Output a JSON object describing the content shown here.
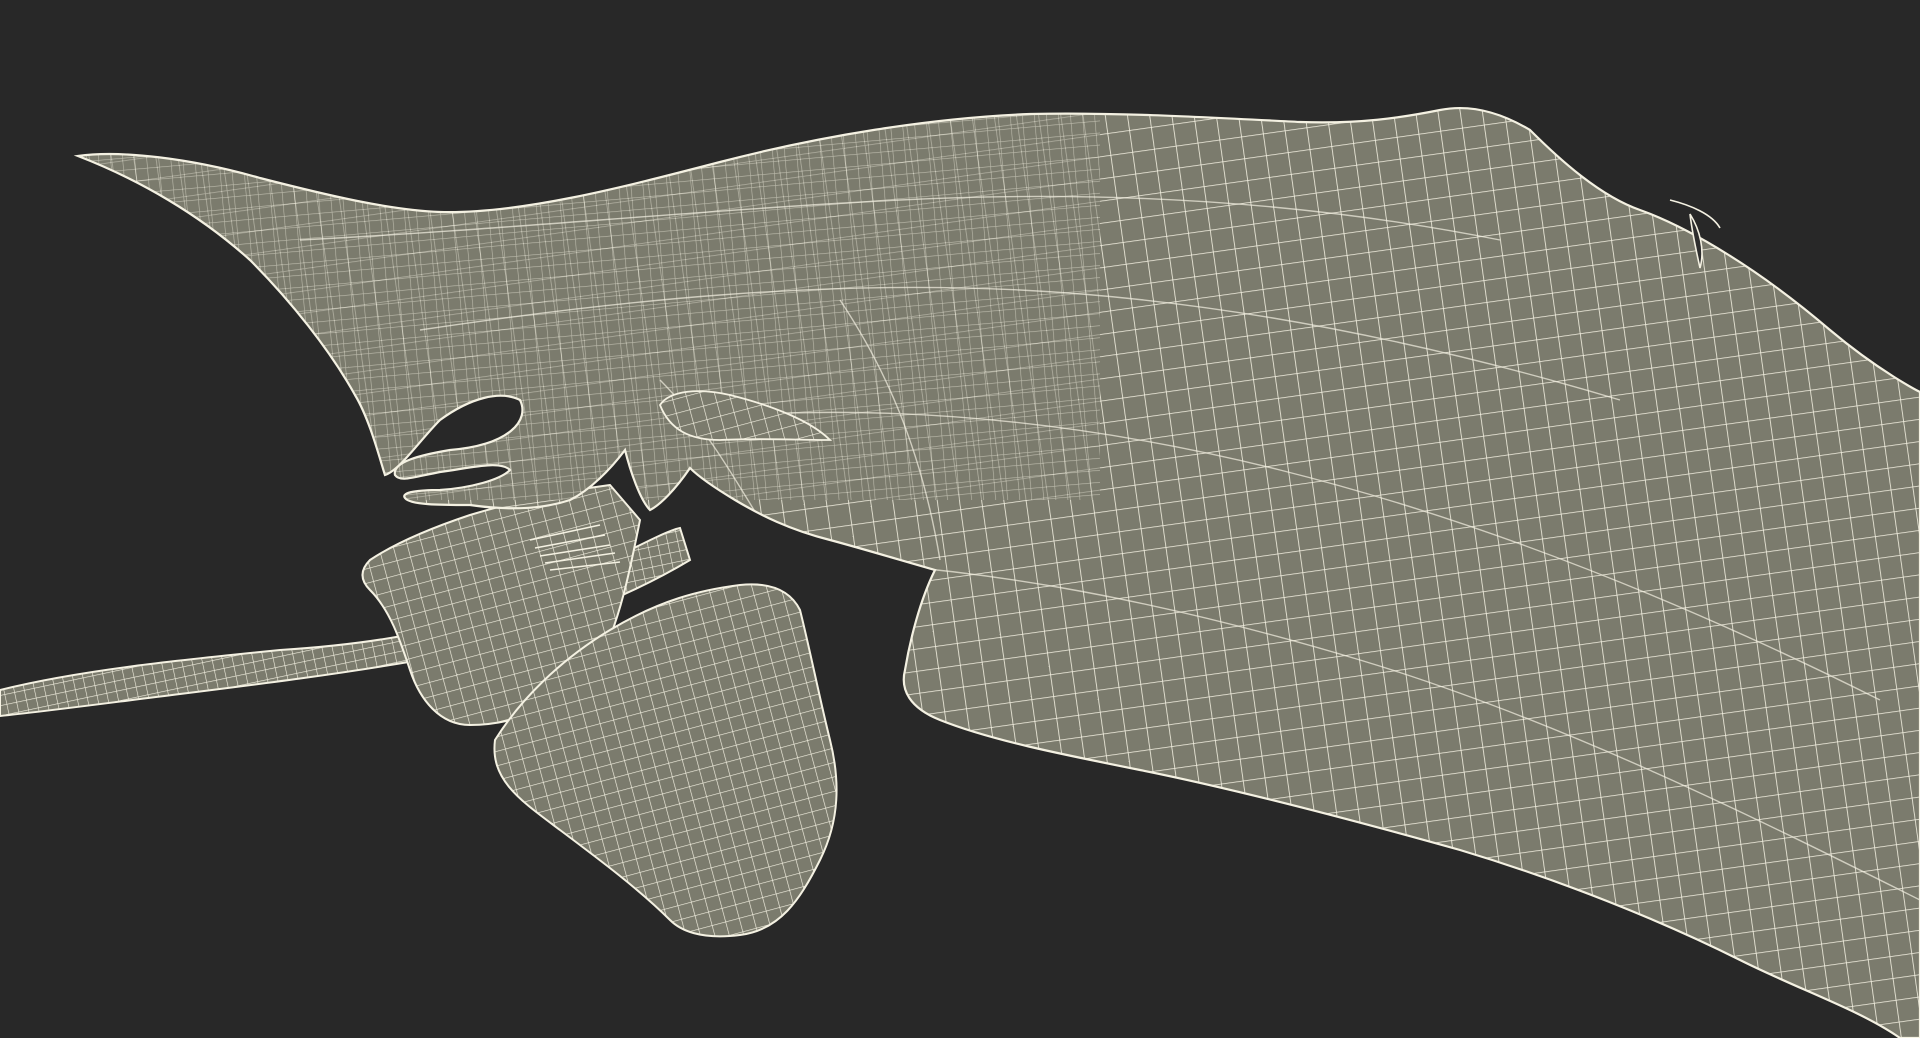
{
  "viewport": {
    "background_color": "#282828",
    "mesh_fill_color": "#7b7b6d",
    "mesh_fill_dark_color": "#6a6a5d",
    "wireframe_color": "#f4f1e2",
    "subject": "stingray-wireframe-model"
  }
}
